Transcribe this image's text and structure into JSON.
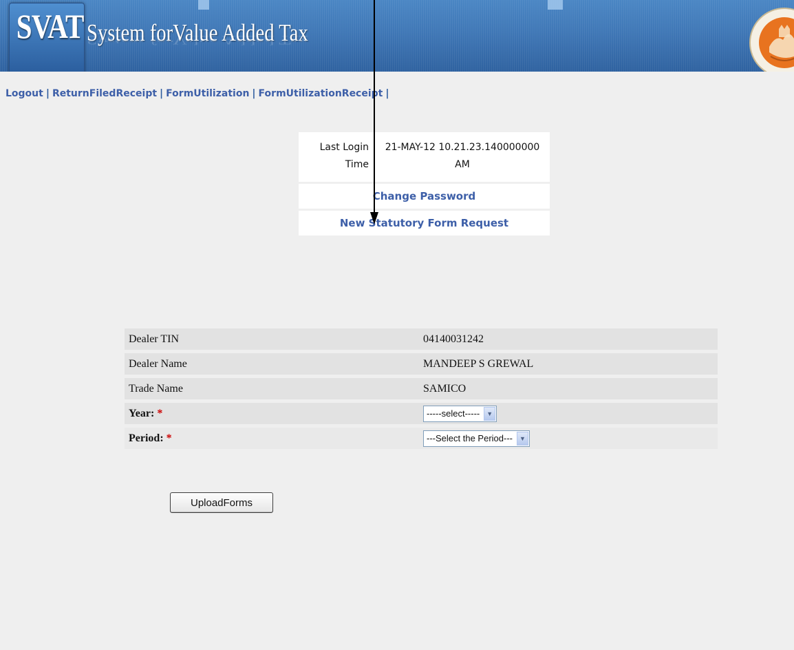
{
  "header": {
    "logo": "SVAT",
    "title": "System forValue Added Tax",
    "colors": {
      "banner": "#3f77b6",
      "link": "#3d5fa8",
      "required": "#cc0000"
    }
  },
  "nav": {
    "items": [
      {
        "label": "Logout"
      },
      {
        "label": "ReturnFiledReceipt"
      },
      {
        "label": "FormUtilization"
      },
      {
        "label": "FormUtilizationReceipt"
      }
    ],
    "separator": "|"
  },
  "login_box": {
    "label_line1": "Last Login",
    "label_line2": "Time",
    "value_line1": "21-MAY-12 10.21.23.140000000",
    "value_line2": "AM",
    "change_password": "Change Password",
    "new_form_request": "New Statutory Form Request"
  },
  "dealer": {
    "tin_label": "Dealer TIN",
    "tin_value": "04140031242",
    "name_label": "Dealer Name",
    "name_value": "MANDEEP S GREWAL",
    "trade_label": "Trade Name",
    "trade_value": "SAMICO",
    "year_label": "Year:",
    "year_selected": "-----select-----",
    "period_label": "Period:",
    "period_selected": "---Select the Period---",
    "required_mark": "*"
  },
  "actions": {
    "upload_label": "UploadForms"
  },
  "icons": [
    "emblem-icon",
    "chevron-down-icon",
    "arrow-down-icon"
  ]
}
